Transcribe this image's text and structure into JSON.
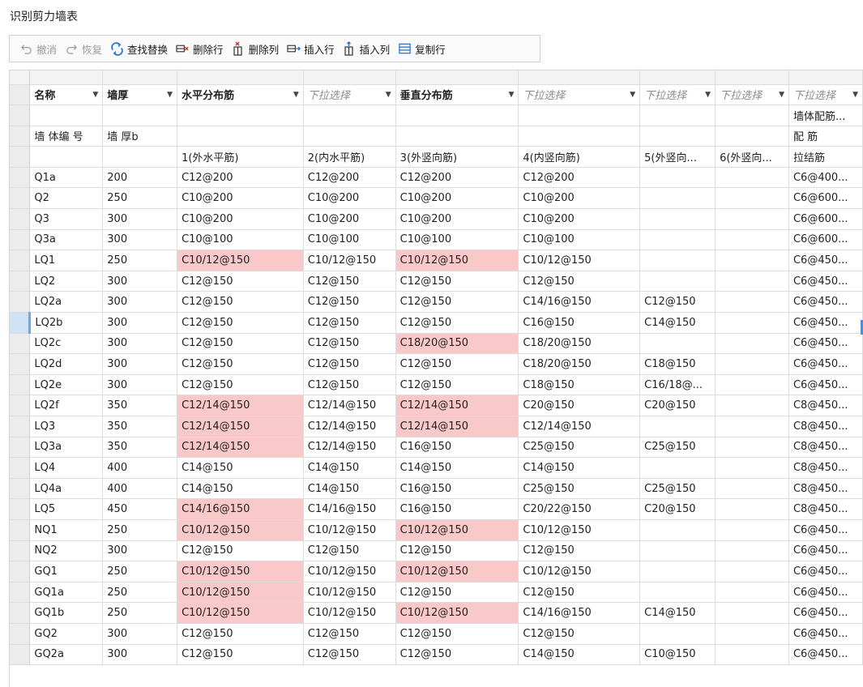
{
  "window": {
    "title": "识别剪力墙表"
  },
  "toolbar": [
    {
      "id": "undo",
      "label": "撤消",
      "icon": "undo-icon",
      "enabled": false
    },
    {
      "id": "redo",
      "label": "恢复",
      "icon": "redo-icon",
      "enabled": false
    },
    {
      "id": "find-replace",
      "label": "查找替换",
      "icon": "find-replace-icon",
      "enabled": true
    },
    {
      "id": "delete-row",
      "label": "删除行",
      "icon": "delete-row-icon",
      "enabled": true
    },
    {
      "id": "delete-col",
      "label": "删除列",
      "icon": "delete-column-icon",
      "enabled": true
    },
    {
      "id": "insert-row",
      "label": "插入行",
      "icon": "insert-row-icon",
      "enabled": true
    },
    {
      "id": "insert-col",
      "label": "插入列",
      "icon": "insert-column-icon",
      "enabled": true
    },
    {
      "id": "copy-row",
      "label": "复制行",
      "icon": "copy-row-icon",
      "enabled": true
    }
  ],
  "colors": {
    "highlight": "#f9c8c8",
    "selection": "#cfe2f6",
    "accent": "#4a90d9"
  },
  "table": {
    "headers": [
      {
        "text": "名称",
        "placeholder": false
      },
      {
        "text": "墙厚",
        "placeholder": false
      },
      {
        "text": "水平分布筋",
        "placeholder": false
      },
      {
        "text": "下拉选择",
        "placeholder": true
      },
      {
        "text": "垂直分布筋",
        "placeholder": false
      },
      {
        "text": "下拉选择",
        "placeholder": true
      },
      {
        "text": "下拉选择",
        "placeholder": true
      },
      {
        "text": "下拉选择",
        "placeholder": true
      },
      {
        "text": "下拉选择",
        "placeholder": true
      }
    ],
    "rows": [
      {
        "cells": [
          "",
          "",
          "",
          "",
          "",
          "",
          "",
          "",
          "墙体配筋..."
        ],
        "hl": []
      },
      {
        "cells": [
          "墙 体编 号",
          "墙 厚b",
          "",
          "",
          "",
          "",
          "",
          "",
          "配 筋"
        ],
        "hl": []
      },
      {
        "cells": [
          "",
          "",
          "1(外水平筋)",
          "2(内水平筋)",
          "3(外竖向筋)",
          "4(内竖向筋)",
          "5(外竖向...",
          "6(外竖向...",
          "拉结筋"
        ],
        "hl": []
      },
      {
        "cells": [
          "Q1a",
          "200",
          "C12@200",
          "C12@200",
          "C12@200",
          "C12@200",
          "",
          "",
          "C6@400..."
        ],
        "hl": []
      },
      {
        "cells": [
          "Q2",
          "250",
          "C10@200",
          "C10@200",
          "C10@200",
          "C10@200",
          "",
          "",
          "C6@600..."
        ],
        "hl": []
      },
      {
        "cells": [
          "Q3",
          "300",
          "C10@200",
          "C10@200",
          "C10@200",
          "C10@200",
          "",
          "",
          "C6@600..."
        ],
        "hl": []
      },
      {
        "cells": [
          "Q3a",
          "300",
          "C10@100",
          "C10@100",
          "C10@100",
          "C10@100",
          "",
          "",
          "C6@600..."
        ],
        "hl": []
      },
      {
        "cells": [
          "LQ1",
          "250",
          "C10/12@150",
          "C10/12@150",
          "C10/12@150",
          "C10/12@150",
          "",
          "",
          "C6@450..."
        ],
        "hl": [
          2,
          4
        ]
      },
      {
        "cells": [
          "LQ2",
          "300",
          "C12@150",
          "C12@150",
          "C12@150",
          "C12@150",
          "",
          "",
          "C6@450..."
        ],
        "hl": []
      },
      {
        "cells": [
          "LQ2a",
          "300",
          "C12@150",
          "C12@150",
          "C12@150",
          "C14/16@150",
          "C12@150",
          "",
          "C6@450..."
        ],
        "hl": []
      },
      {
        "cells": [
          "LQ2b",
          "300",
          "C12@150",
          "C12@150",
          "C12@150",
          "C16@150",
          "C14@150",
          "",
          "C6@450..."
        ],
        "hl": [],
        "selected": true
      },
      {
        "cells": [
          "LQ2c",
          "300",
          "C12@150",
          "C12@150",
          "C18/20@150",
          "C18/20@150",
          "",
          "",
          "C6@450..."
        ],
        "hl": [
          4
        ]
      },
      {
        "cells": [
          "LQ2d",
          "300",
          "C12@150",
          "C12@150",
          "C12@150",
          "C18/20@150",
          "C18@150",
          "",
          "C6@450..."
        ],
        "hl": []
      },
      {
        "cells": [
          "LQ2e",
          "300",
          "C12@150",
          "C12@150",
          "C12@150",
          "C18@150",
          "C16/18@...",
          "",
          "C6@450..."
        ],
        "hl": []
      },
      {
        "cells": [
          "LQ2f",
          "350",
          "C12/14@150",
          "C12/14@150",
          "C12/14@150",
          "C20@150",
          "C20@150",
          "",
          "C8@450..."
        ],
        "hl": [
          2,
          4
        ]
      },
      {
        "cells": [
          "LQ3",
          "350",
          "C12/14@150",
          "C12/14@150",
          "C12/14@150",
          "C12/14@150",
          "",
          "",
          "C8@450..."
        ],
        "hl": [
          2,
          4
        ]
      },
      {
        "cells": [
          "LQ3a",
          "350",
          "C12/14@150",
          "C12/14@150",
          "C16@150",
          "C25@150",
          "C25@150",
          "",
          "C8@450..."
        ],
        "hl": [
          2
        ]
      },
      {
        "cells": [
          "LQ4",
          "400",
          "C14@150",
          "C14@150",
          "C14@150",
          "C14@150",
          "",
          "",
          "C8@450..."
        ],
        "hl": []
      },
      {
        "cells": [
          "LQ4a",
          "400",
          "C14@150",
          "C14@150",
          "C16@150",
          "C25@150",
          "C25@150",
          "",
          "C8@450..."
        ],
        "hl": []
      },
      {
        "cells": [
          "LQ5",
          "450",
          "C14/16@150",
          "C14/16@150",
          "C16@150",
          "C20/22@150",
          "C20@150",
          "",
          "C8@450..."
        ],
        "hl": [
          2
        ]
      },
      {
        "cells": [
          "NQ1",
          "250",
          "C10/12@150",
          "C10/12@150",
          "C10/12@150",
          "C10/12@150",
          "",
          "",
          "C6@450..."
        ],
        "hl": [
          2,
          4
        ]
      },
      {
        "cells": [
          "NQ2",
          "300",
          "C12@150",
          "C12@150",
          "C12@150",
          "C12@150",
          "",
          "",
          "C6@450..."
        ],
        "hl": []
      },
      {
        "cells": [
          "GQ1",
          "250",
          "C10/12@150",
          "C10/12@150",
          "C10/12@150",
          "C10/12@150",
          "",
          "",
          "C6@450..."
        ],
        "hl": [
          2,
          4
        ]
      },
      {
        "cells": [
          "GQ1a",
          "250",
          "C10/12@150",
          "C10/12@150",
          "C12@150",
          "C12@150",
          "",
          "",
          "C6@450..."
        ],
        "hl": [
          2
        ]
      },
      {
        "cells": [
          "GQ1b",
          "250",
          "C10/12@150",
          "C10/12@150",
          "C10/12@150",
          "C14/16@150",
          "C14@150",
          "",
          "C6@450..."
        ],
        "hl": [
          2,
          4
        ]
      },
      {
        "cells": [
          "GQ2",
          "300",
          "C12@150",
          "C12@150",
          "C12@150",
          "C12@150",
          "",
          "",
          "C6@450..."
        ],
        "hl": []
      },
      {
        "cells": [
          "GQ2a",
          "300",
          "C12@150",
          "C12@150",
          "C12@150",
          "C14@150",
          "C10@150",
          "",
          "C6@450..."
        ],
        "hl": []
      }
    ]
  }
}
